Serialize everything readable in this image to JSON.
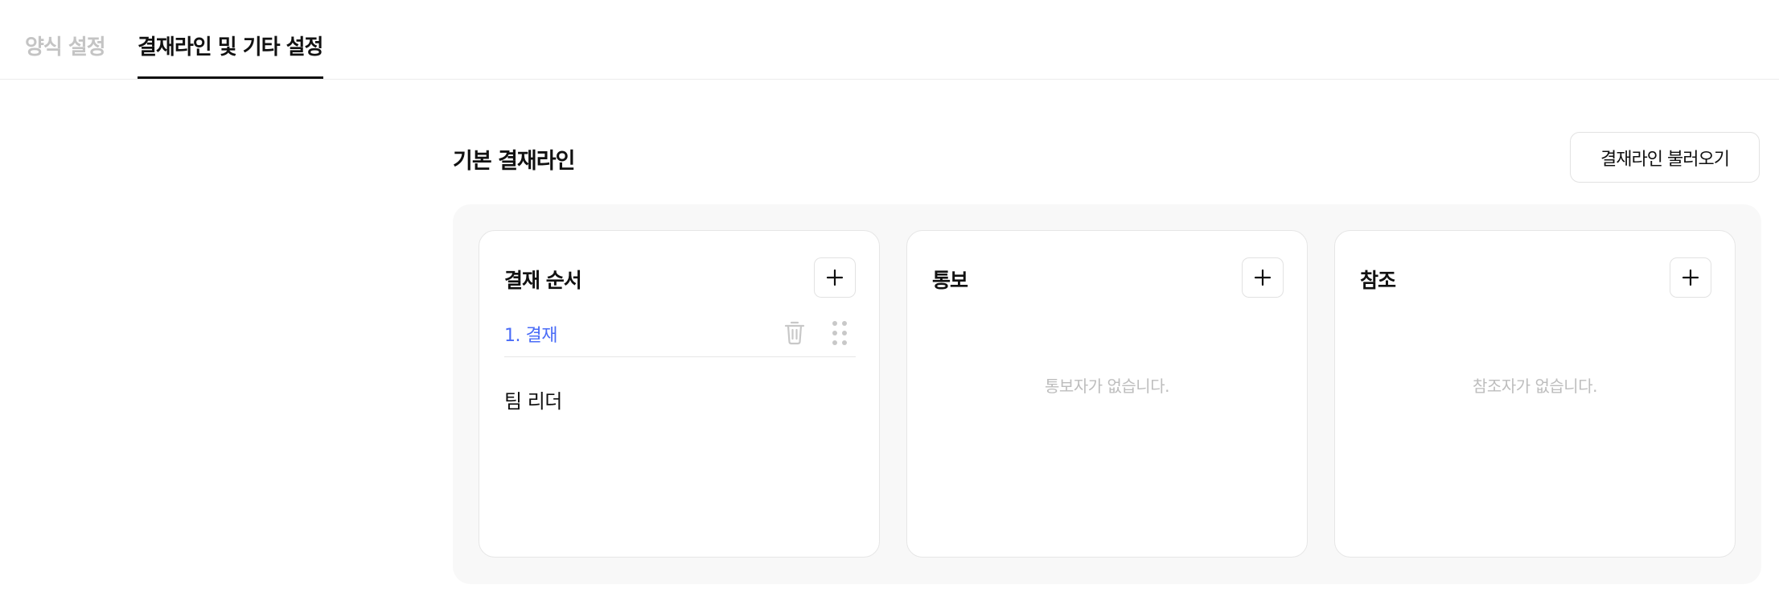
{
  "tabs": {
    "form_settings": "양식 설정",
    "approval_settings": "결재라인 및 기타 설정",
    "active": "approval_settings"
  },
  "section": {
    "title": "기본 결재라인",
    "load_button": "결재라인 불러오기"
  },
  "cards": {
    "approval": {
      "title": "결재 순서",
      "add_icon": "plus-icon",
      "steps": [
        {
          "label": "1. 결재",
          "member": "팀 리더",
          "delete_icon": "trash-icon",
          "drag_icon": "drag-handle-icon"
        }
      ]
    },
    "notify": {
      "title": "통보",
      "add_icon": "plus-icon",
      "empty_text": "통보자가 없습니다."
    },
    "reference": {
      "title": "참조",
      "add_icon": "plus-icon",
      "empty_text": "참조자가 없습니다."
    }
  },
  "colors": {
    "accent": "#4a6cf7",
    "inactive_tab": "#c4c4c4",
    "panel_bg": "#f8f8f8",
    "empty_text": "#bdbdbd"
  }
}
